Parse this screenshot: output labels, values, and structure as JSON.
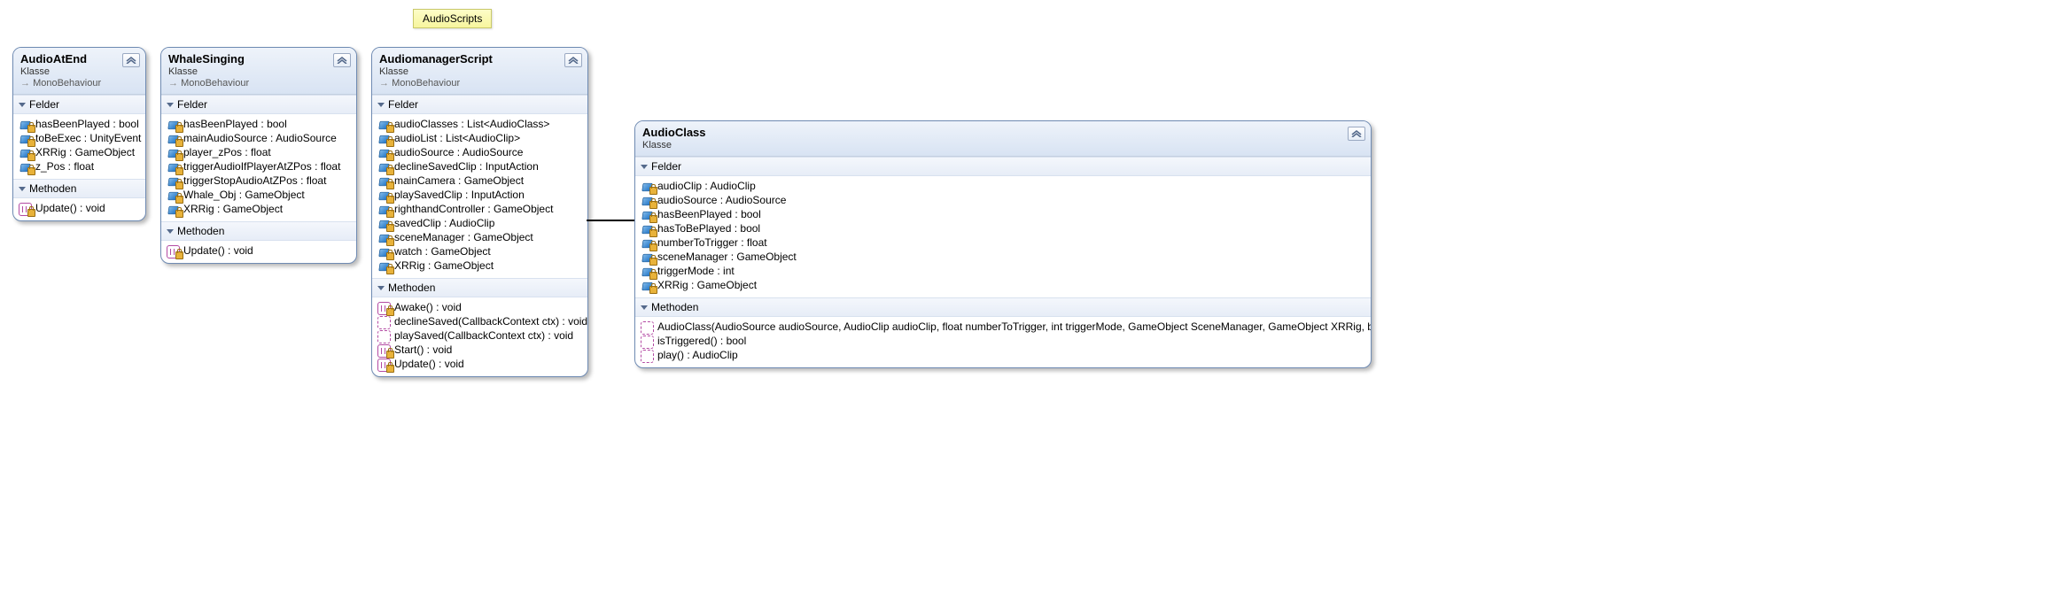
{
  "note": {
    "text": "AudioScripts"
  },
  "classes": {
    "audioAtEnd": {
      "name": "AudioAtEnd",
      "kind": "Klasse",
      "base": "MonoBehaviour",
      "sections": {
        "fields": {
          "title": "Felder",
          "items": [
            {
              "sig": "hasBeenPlayed : bool",
              "lock": true
            },
            {
              "sig": "toBeExec : UnityEvent",
              "lock": true
            },
            {
              "sig": "XRRig : GameObject",
              "lock": true
            },
            {
              "sig": "z_Pos : float",
              "lock": true
            }
          ]
        },
        "methods": {
          "title": "Methoden",
          "items": [
            {
              "sig": "Update() : void",
              "icon": "method",
              "lock": true
            }
          ]
        }
      }
    },
    "whaleSinging": {
      "name": "WhaleSinging",
      "kind": "Klasse",
      "base": "MonoBehaviour",
      "sections": {
        "fields": {
          "title": "Felder",
          "items": [
            {
              "sig": "hasBeenPlayed : bool",
              "lock": true
            },
            {
              "sig": "mainAudioSource : AudioSource",
              "lock": true
            },
            {
              "sig": "player_zPos : float",
              "lock": true
            },
            {
              "sig": "triggerAudioIfPlayerAtZPos : float",
              "lock": true
            },
            {
              "sig": "triggerStopAudioAtZPos : float",
              "lock": true
            },
            {
              "sig": "Whale_Obj : GameObject",
              "lock": true
            },
            {
              "sig": "XRRig : GameObject",
              "lock": true
            }
          ]
        },
        "methods": {
          "title": "Methoden",
          "items": [
            {
              "sig": "Update() : void",
              "icon": "method",
              "lock": true
            }
          ]
        }
      }
    },
    "audiomanagerScript": {
      "name": "AudiomanagerScript",
      "kind": "Klasse",
      "base": "MonoBehaviour",
      "sections": {
        "fields": {
          "title": "Felder",
          "items": [
            {
              "sig": "audioClasses : List<AudioClass>",
              "lock": true
            },
            {
              "sig": "audioList : List<AudioClip>",
              "lock": true
            },
            {
              "sig": "audioSource : AudioSource",
              "lock": true
            },
            {
              "sig": "declineSavedClip : InputAction",
              "lock": true
            },
            {
              "sig": "mainCamera : GameObject",
              "lock": true
            },
            {
              "sig": "playSavedClip : InputAction",
              "lock": true
            },
            {
              "sig": "righthandController : GameObject",
              "lock": true
            },
            {
              "sig": "savedClip : AudioClip",
              "lock": true
            },
            {
              "sig": "sceneManager : GameObject",
              "lock": true
            },
            {
              "sig": "watch : GameObject",
              "lock": true
            },
            {
              "sig": "XRRig : GameObject",
              "lock": true
            }
          ]
        },
        "methods": {
          "title": "Methoden",
          "items": [
            {
              "sig": "Awake() : void",
              "icon": "method",
              "lock": true
            },
            {
              "sig": "declineSaved(CallbackContext ctx) : void",
              "icon": "ctor"
            },
            {
              "sig": "playSaved(CallbackContext ctx) : void",
              "icon": "ctor"
            },
            {
              "sig": "Start() : void",
              "icon": "method",
              "lock": true
            },
            {
              "sig": "Update() : void",
              "icon": "method",
              "lock": true
            }
          ]
        }
      }
    },
    "audioClass": {
      "name": "AudioClass",
      "kind": "Klasse",
      "base": null,
      "sections": {
        "fields": {
          "title": "Felder",
          "items": [
            {
              "sig": "audioClip : AudioClip",
              "lock": true
            },
            {
              "sig": "audioSource : AudioSource",
              "lock": true
            },
            {
              "sig": "hasBeenPlayed : bool",
              "lock": true
            },
            {
              "sig": "hasToBePlayed : bool",
              "lock": true
            },
            {
              "sig": "numberToTrigger : float",
              "lock": true
            },
            {
              "sig": "sceneManager : GameObject",
              "lock": true
            },
            {
              "sig": "triggerMode : int",
              "lock": true
            },
            {
              "sig": "XRRig : GameObject",
              "lock": true
            }
          ]
        },
        "methods": {
          "title": "Methoden",
          "items": [
            {
              "sig": "AudioClass(AudioSource audioSource, AudioClip audioClip, float numberToTrigger, int triggerMode, GameObject SceneManager, GameObject XRRig, bool hasToBePlayed)",
              "icon": "ctor"
            },
            {
              "sig": "isTriggered() : bool",
              "icon": "ctor"
            },
            {
              "sig": "play() : AudioClip",
              "icon": "ctor"
            }
          ]
        }
      }
    }
  }
}
